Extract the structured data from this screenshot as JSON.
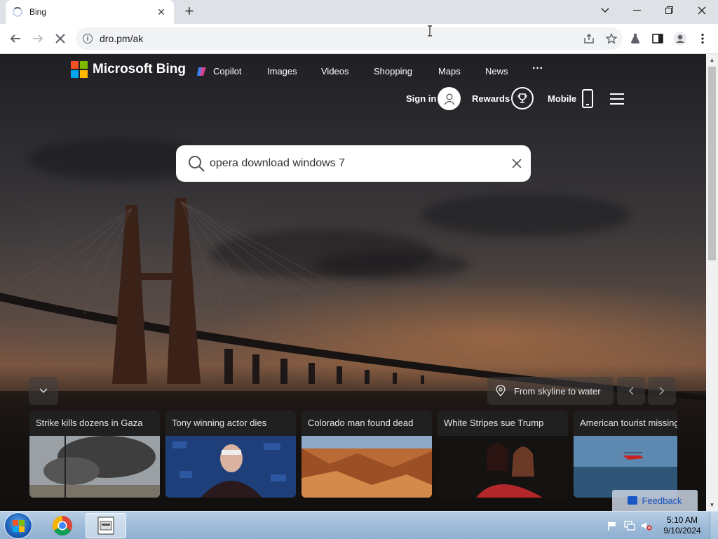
{
  "browser": {
    "tab_title": "Bing",
    "url": "dro.pm/ak"
  },
  "bing": {
    "logo_text": "Microsoft Bing",
    "nav": [
      "Copilot",
      "Images",
      "Videos",
      "Shopping",
      "Maps",
      "News"
    ],
    "more_label": "···",
    "sign_in": "Sign in",
    "rewards": "Rewards",
    "mobile": "Mobile",
    "search_value": "opera download windows 7",
    "caption": "From skyline to water",
    "feedback": "Feedback",
    "cards": [
      {
        "title": "Strike kills dozens in Gaza"
      },
      {
        "title": "Tony winning actor dies"
      },
      {
        "title": "Colorado man found dead"
      },
      {
        "title": "White Stripes sue Trump"
      },
      {
        "title": "American tourist missing"
      }
    ],
    "logo_colors": [
      "#f25022",
      "#7fba00",
      "#00a4ef",
      "#ffb900"
    ]
  },
  "taskbar": {
    "time": "5:10 AM",
    "date": "9/10/2024"
  }
}
